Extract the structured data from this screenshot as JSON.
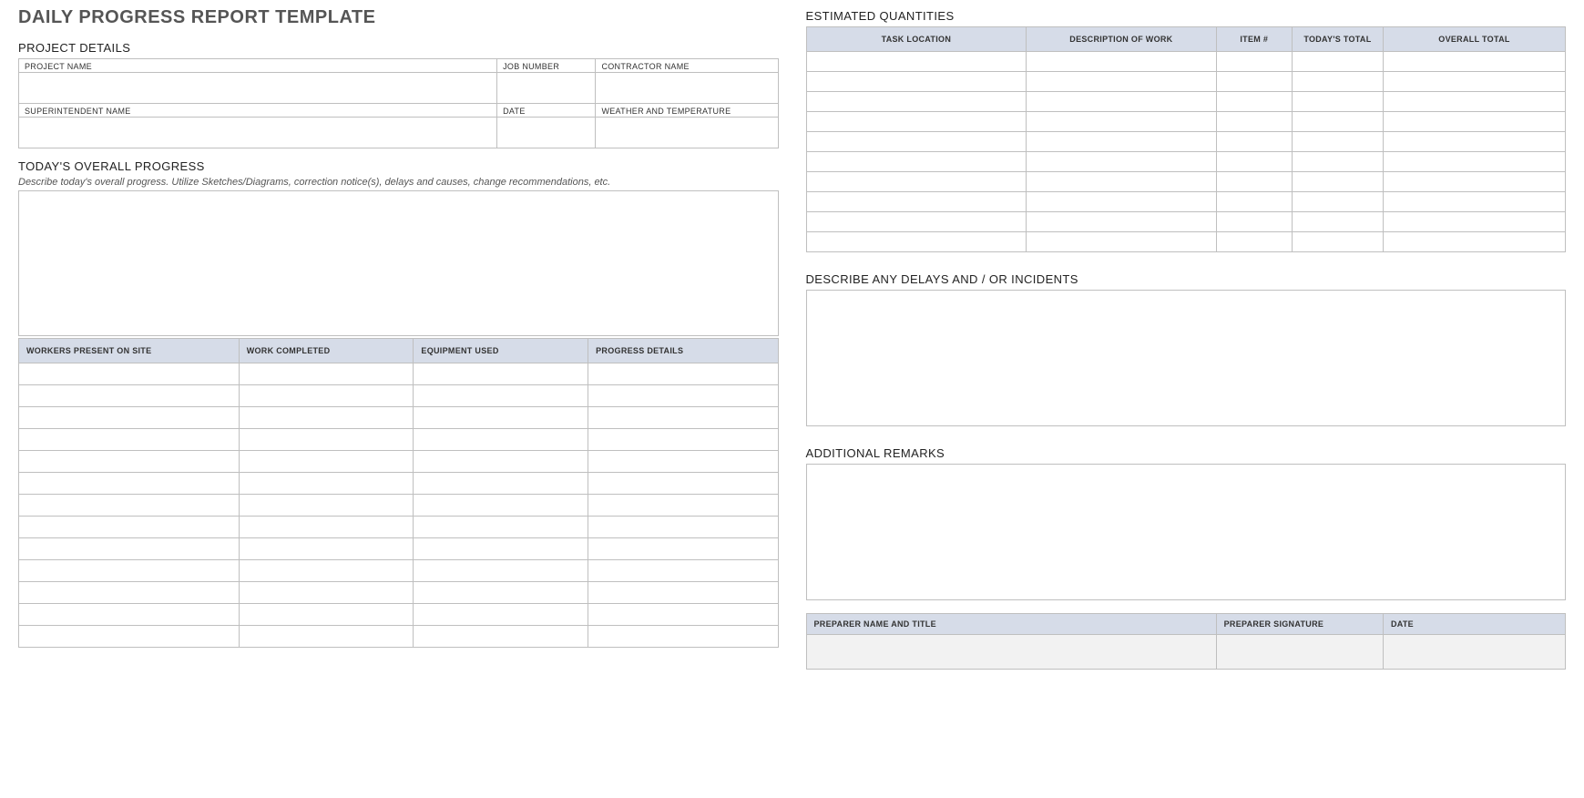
{
  "title": "DAILY PROGRESS REPORT TEMPLATE",
  "sections": {
    "project_details": "PROJECT DETAILS",
    "todays_progress": "TODAY'S OVERALL PROGRESS",
    "progress_hint": "Describe today's overall progress.  Utilize Sketches/Diagrams, correction notice(s), delays and causes, change recommendations, etc.",
    "estimated_quantities": "ESTIMATED QUANTITIES",
    "delays": "DESCRIBE ANY DELAYS AND / OR INCIDENTS",
    "remarks": "ADDITIONAL REMARKS"
  },
  "details": {
    "project_name_label": "PROJECT NAME",
    "job_number_label": "JOB NUMBER",
    "contractor_name_label": "CONTRACTOR NAME",
    "superintendent_label": "SUPERINTENDENT NAME",
    "date_label": "DATE",
    "weather_label": "WEATHER AND TEMPERATURE",
    "project_name": "",
    "job_number": "",
    "contractor_name": "",
    "superintendent": "",
    "date": "",
    "weather": ""
  },
  "progress_table": {
    "headers": {
      "workers": "WORKERS PRESENT ON SITE",
      "work": "WORK COMPLETED",
      "equipment": "EQUIPMENT USED",
      "details": "PROGRESS DETAILS"
    },
    "rows": [
      {
        "workers": "",
        "work": "",
        "equipment": "",
        "details": ""
      },
      {
        "workers": "",
        "work": "",
        "equipment": "",
        "details": ""
      },
      {
        "workers": "",
        "work": "",
        "equipment": "",
        "details": ""
      },
      {
        "workers": "",
        "work": "",
        "equipment": "",
        "details": ""
      },
      {
        "workers": "",
        "work": "",
        "equipment": "",
        "details": ""
      },
      {
        "workers": "",
        "work": "",
        "equipment": "",
        "details": ""
      },
      {
        "workers": "",
        "work": "",
        "equipment": "",
        "details": ""
      },
      {
        "workers": "",
        "work": "",
        "equipment": "",
        "details": ""
      },
      {
        "workers": "",
        "work": "",
        "equipment": "",
        "details": ""
      },
      {
        "workers": "",
        "work": "",
        "equipment": "",
        "details": ""
      },
      {
        "workers": "",
        "work": "",
        "equipment": "",
        "details": ""
      },
      {
        "workers": "",
        "work": "",
        "equipment": "",
        "details": ""
      },
      {
        "workers": "",
        "work": "",
        "equipment": "",
        "details": ""
      }
    ]
  },
  "quantities_table": {
    "headers": {
      "location": "TASK LOCATION",
      "description": "DESCRIPTION OF WORK",
      "item": "ITEM #",
      "today": "TODAY'S TOTAL",
      "overall": "OVERALL TOTAL"
    },
    "rows": [
      {
        "location": "",
        "description": "",
        "item": "",
        "today": "",
        "overall": ""
      },
      {
        "location": "",
        "description": "",
        "item": "",
        "today": "",
        "overall": ""
      },
      {
        "location": "",
        "description": "",
        "item": "",
        "today": "",
        "overall": ""
      },
      {
        "location": "",
        "description": "",
        "item": "",
        "today": "",
        "overall": ""
      },
      {
        "location": "",
        "description": "",
        "item": "",
        "today": "",
        "overall": ""
      },
      {
        "location": "",
        "description": "",
        "item": "",
        "today": "",
        "overall": ""
      },
      {
        "location": "",
        "description": "",
        "item": "",
        "today": "",
        "overall": ""
      },
      {
        "location": "",
        "description": "",
        "item": "",
        "today": "",
        "overall": ""
      },
      {
        "location": "",
        "description": "",
        "item": "",
        "today": "",
        "overall": ""
      },
      {
        "location": "",
        "description": "",
        "item": "",
        "today": "",
        "overall": ""
      }
    ]
  },
  "signoff": {
    "preparer_label": "PREPARER NAME AND TITLE",
    "signature_label": "PREPARER SIGNATURE",
    "date_label": "DATE",
    "preparer": "",
    "signature": "",
    "date": ""
  },
  "progress_text": "",
  "delays_text": "",
  "remarks_text": ""
}
